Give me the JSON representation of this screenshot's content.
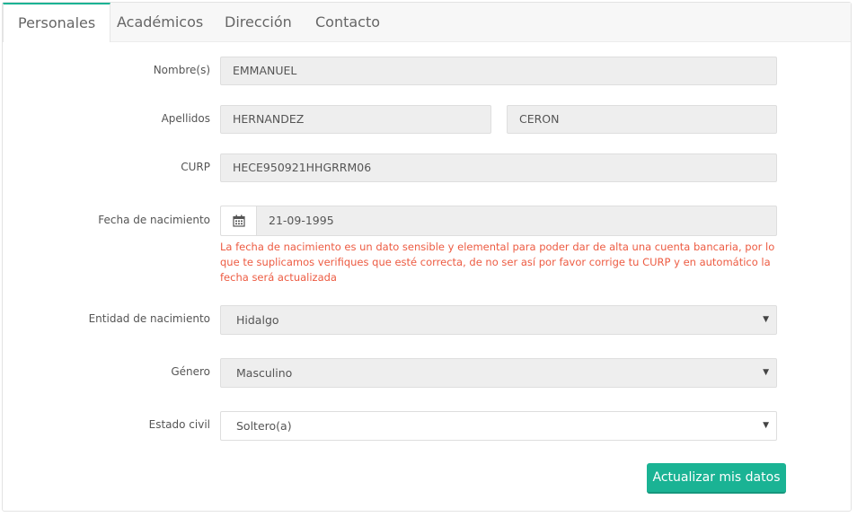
{
  "tabs": [
    {
      "label": "Personales",
      "active": true
    },
    {
      "label": "Académicos",
      "active": false
    },
    {
      "label": "Dirección",
      "active": false
    },
    {
      "label": "Contacto",
      "active": false
    }
  ],
  "form": {
    "nombre": {
      "label": "Nombre(s)",
      "value": "EMMANUEL"
    },
    "apellidos": {
      "label": "Apellidos",
      "paterno": "HERNANDEZ",
      "materno": "CERON"
    },
    "curp": {
      "label": "CURP",
      "value": "HECE950921HHGRRM06"
    },
    "fecha": {
      "label": "Fecha de nacimiento",
      "value": "21-09-1995",
      "icon": "calendar-icon",
      "hint": "La fecha de nacimiento es un dato sensible y elemental para poder dar de alta una cuenta bancaria, por lo que te suplicamos verifiques que esté correcta, de no ser así por favor corrige tu CURP y en automático la fecha será actualizada"
    },
    "entidad": {
      "label": "Entidad de nacimiento",
      "value": "Hidalgo"
    },
    "genero": {
      "label": "Género",
      "value": "Masculino"
    },
    "estado_civil": {
      "label": "Estado civil",
      "value": "Soltero(a)"
    }
  },
  "actions": {
    "submit_label": "Actualizar mis datos"
  },
  "colors": {
    "accent": "#1ab394",
    "hint": "#ed5b42",
    "readonly_bg": "#eeeeee"
  }
}
